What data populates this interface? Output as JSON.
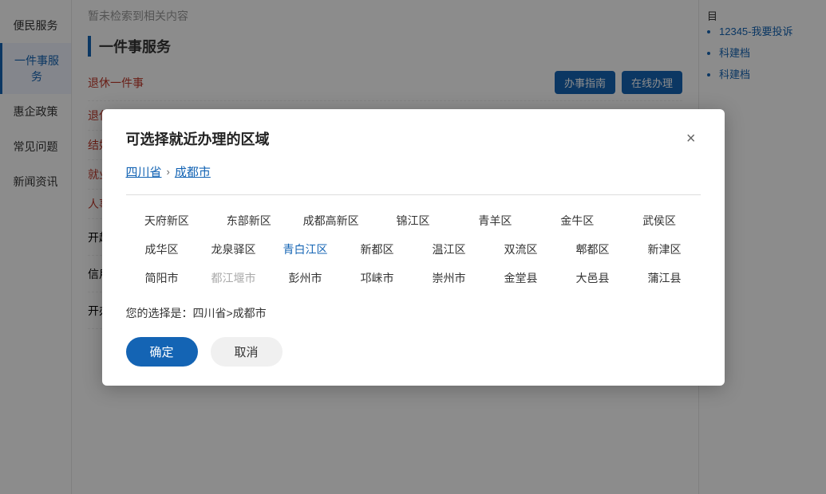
{
  "sidebar": {
    "items": [
      {
        "label": "便民服务",
        "active": false
      },
      {
        "label": "一件事服务",
        "active": true
      },
      {
        "label": "惠企政策",
        "active": false
      },
      {
        "label": "常见问题",
        "active": false
      },
      {
        "label": "新闻资讯",
        "active": false
      }
    ]
  },
  "main": {
    "no_result": "暂未检索到相关内容",
    "section_title": "一件事服务",
    "list_items": [
      {
        "label": "退休一件",
        "red": true
      },
      {
        "label": "退休一件",
        "red": true
      },
      {
        "label": "结婚一件",
        "red": true
      },
      {
        "label": "就业一件",
        "red": true
      },
      {
        "label": "人事档案",
        "red": true
      },
      {
        "label": "开超市一件事",
        "red": true
      },
      {
        "label": "信用修复一件事",
        "red": true
      },
      {
        "label": "开办医院一件事",
        "red": true
      }
    ],
    "btn_guide": "办事指南",
    "btn_online": "在线办理"
  },
  "right_panel": {
    "label": "目",
    "list": [
      {
        "text": "12345-我要投诉"
      },
      {
        "text": "科建档"
      },
      {
        "text": "科建档"
      }
    ]
  },
  "modal": {
    "title": "可选择就近办理的区域",
    "close_label": "×",
    "breadcrumb": {
      "province": "四川省",
      "city": "成都市",
      "arrow": "›"
    },
    "areas_row1": [
      {
        "label": "天府新区",
        "disabled": false,
        "highlighted": false
      },
      {
        "label": "东部新区",
        "disabled": false,
        "highlighted": false
      },
      {
        "label": "成都高新区",
        "disabled": false,
        "highlighted": false
      },
      {
        "label": "锦江区",
        "disabled": false,
        "highlighted": false
      },
      {
        "label": "青羊区",
        "disabled": false,
        "highlighted": false
      },
      {
        "label": "金牛区",
        "disabled": false,
        "highlighted": false
      },
      {
        "label": "武侯区",
        "disabled": false,
        "highlighted": false
      }
    ],
    "areas_row2": [
      {
        "label": "成华区",
        "disabled": false,
        "highlighted": false
      },
      {
        "label": "龙泉驿区",
        "disabled": false,
        "highlighted": false
      },
      {
        "label": "青白江区",
        "disabled": false,
        "highlighted": true
      },
      {
        "label": "新都区",
        "disabled": false,
        "highlighted": false
      },
      {
        "label": "温江区",
        "disabled": false,
        "highlighted": false
      },
      {
        "label": "双流区",
        "disabled": false,
        "highlighted": false
      },
      {
        "label": "郫都区",
        "disabled": false,
        "highlighted": false
      },
      {
        "label": "新津区",
        "disabled": false,
        "highlighted": false
      }
    ],
    "areas_row3": [
      {
        "label": "简阳市",
        "disabled": false,
        "highlighted": false
      },
      {
        "label": "都江堰市",
        "disabled": true,
        "highlighted": false
      },
      {
        "label": "彭州市",
        "disabled": false,
        "highlighted": false
      },
      {
        "label": "邛崃市",
        "disabled": false,
        "highlighted": false
      },
      {
        "label": "崇州市",
        "disabled": false,
        "highlighted": false
      },
      {
        "label": "金堂县",
        "disabled": false,
        "highlighted": false
      },
      {
        "label": "大邑县",
        "disabled": false,
        "highlighted": false
      },
      {
        "label": "蒲江县",
        "disabled": false,
        "highlighted": false
      }
    ],
    "selection_label": "您的选择是：",
    "selection_value": "四川省>成都市",
    "confirm_btn": "确定",
    "cancel_btn": "取消"
  }
}
